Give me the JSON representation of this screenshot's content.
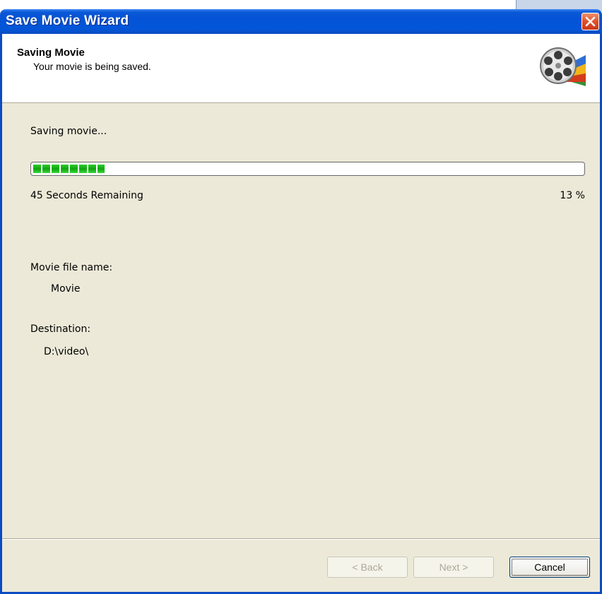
{
  "window": {
    "title": "Save Movie Wizard"
  },
  "header": {
    "title": "Saving Movie",
    "subtitle": "Your movie is being saved."
  },
  "progress": {
    "status_label": "Saving movie...",
    "time_remaining": "45 Seconds Remaining",
    "percent_text": "13 %",
    "percent": 13
  },
  "details": {
    "file_name_label": "Movie file name:",
    "file_name_value": "Movie",
    "destination_label": "Destination:",
    "destination_value": "D:\\video\\"
  },
  "buttons": {
    "back": "< Back",
    "next": "Next >",
    "cancel": "Cancel"
  },
  "icons": {
    "close": "close-icon",
    "film_reel": "film-reel-icon"
  },
  "colors": {
    "titlebar": "#0453d6",
    "progress_fill": "#1ec41e",
    "dialog_bg": "#ece9d8"
  }
}
